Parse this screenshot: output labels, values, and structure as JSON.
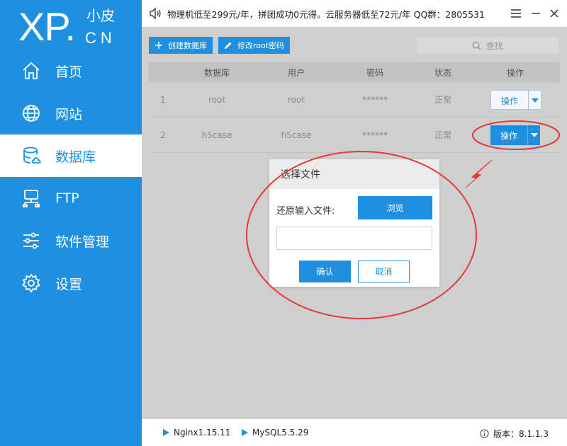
{
  "app": {
    "logo_main": "XP.",
    "logo_top": "小皮",
    "logo_bottom": "CN"
  },
  "sidebar": {
    "items": [
      {
        "label": "首页",
        "icon": "home-icon"
      },
      {
        "label": "网站",
        "icon": "globe-icon"
      },
      {
        "label": "数据库",
        "icon": "database-icon",
        "active": true
      },
      {
        "label": "FTP",
        "icon": "ftp-icon"
      },
      {
        "label": "软件管理",
        "icon": "sliders-icon"
      },
      {
        "label": "设置",
        "icon": "gear-icon"
      }
    ]
  },
  "topbar": {
    "notice": "物理机低至299元/年，拼团成功0元得。云服务器低至72元/年  QQ群：2805531"
  },
  "toolbar": {
    "create_db": "创建数据库",
    "change_root_pw": "修改root密码",
    "search_placeholder": "查找"
  },
  "table": {
    "headers": [
      "数据库",
      "用户",
      "密码",
      "状态",
      "操作"
    ],
    "rows": [
      {
        "index": "1",
        "database": "root",
        "user": "root",
        "password": "******",
        "status": "正常",
        "action": "操作"
      },
      {
        "index": "2",
        "database": "h5case",
        "user": "h5case",
        "password": "******",
        "status": "正常",
        "action": "操作"
      }
    ]
  },
  "dialog": {
    "title": "选择文件",
    "label": "还原输入文件:",
    "browse": "浏览",
    "input_value": "",
    "ok": "确认",
    "cancel": "取消"
  },
  "statusbar": {
    "nginx": "Nginx1.15.11",
    "mysql": "MySQL5.5.29",
    "version": "版本：8.1.1.3"
  },
  "colors": {
    "primary": "#1e8fe1",
    "annotation": "#e53935"
  }
}
